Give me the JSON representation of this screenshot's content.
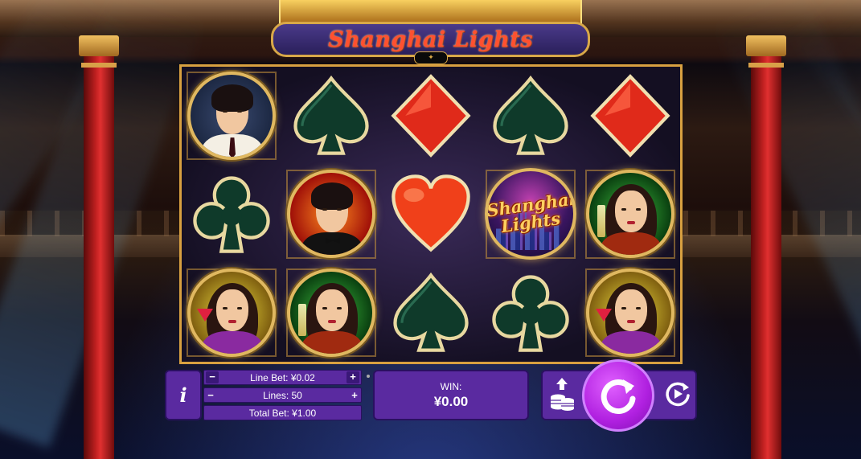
{
  "game": {
    "title": "Shanghai Lights"
  },
  "reels": [
    [
      "man-white-suit",
      "spade",
      "diamond",
      "spade",
      "diamond"
    ],
    [
      "club",
      "man-tuxedo",
      "heart",
      "shanghai-lights-wild",
      "woman-green-dress"
    ],
    [
      "woman-purple-dress",
      "woman-green-dress",
      "spade",
      "club",
      "woman-purple-dress"
    ]
  ],
  "wild_symbol": {
    "line1": "Shanghai",
    "line2": "Lights"
  },
  "controls": {
    "info_label": "i",
    "line_bet_label": "Line Bet: ¥0.02",
    "lines_label": "Lines: 50",
    "total_bet_label": "Total Bet: ¥1.00",
    "minus": "−",
    "plus": "+",
    "win_label": "WIN:",
    "win_value": "¥0.00"
  },
  "colors": {
    "panel": "#5a2aa0",
    "spin": "#b020e0",
    "reel_border": "#d8a040",
    "logo_text": "#ff5030"
  },
  "icons": {
    "spin": "spin-arrow-icon",
    "autoplay": "autoplay-icon",
    "max_bet": "coin-stack-up-icon"
  }
}
